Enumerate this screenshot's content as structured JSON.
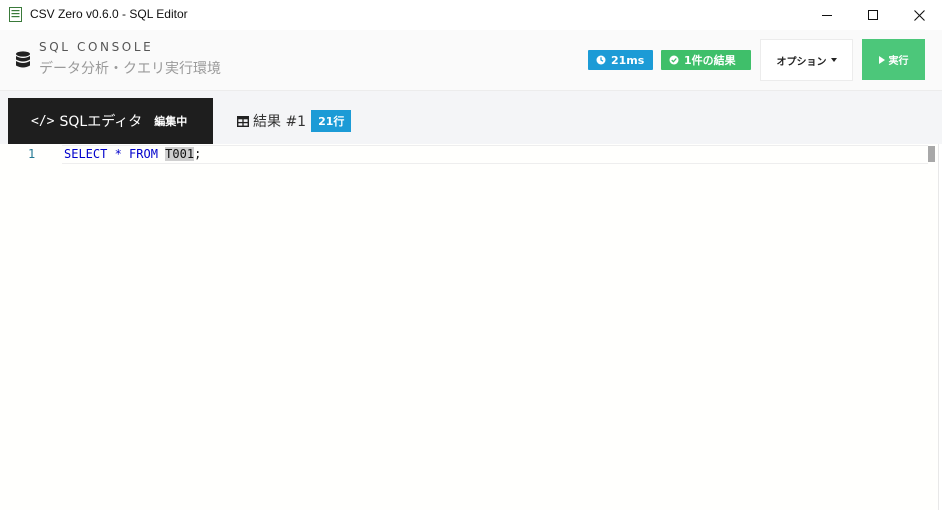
{
  "window": {
    "title": "CSV Zero v0.6.0 - SQL Editor"
  },
  "header": {
    "brand_title": "SQL CONSOLE",
    "brand_subtitle": "データ分析・クエリ実行環境",
    "timing_badge": "21ms",
    "result_badge": "1件の結果",
    "options_label": "オプション",
    "run_label": "実行"
  },
  "tabs": {
    "editor_label": "SQLエディタ",
    "editor_tag": "編集中",
    "result_label": "結果 #1",
    "result_rows": "21行"
  },
  "editor": {
    "line_number": "1",
    "code": {
      "keyword_part": "SELECT * FROM ",
      "table": "T001",
      "end": ";"
    }
  },
  "colors": {
    "accent_blue": "#1c9bd6",
    "accent_green": "#3fbf6a",
    "run_green": "#4cc77a",
    "editor_tab_bg": "#1e1e1e"
  },
  "icons": [
    "app-icon",
    "minimize-icon",
    "maximize-icon",
    "close-icon",
    "database-icon",
    "clock-icon",
    "check-circle-icon",
    "caret-down-icon",
    "play-icon",
    "code-icon",
    "table-icon"
  ]
}
